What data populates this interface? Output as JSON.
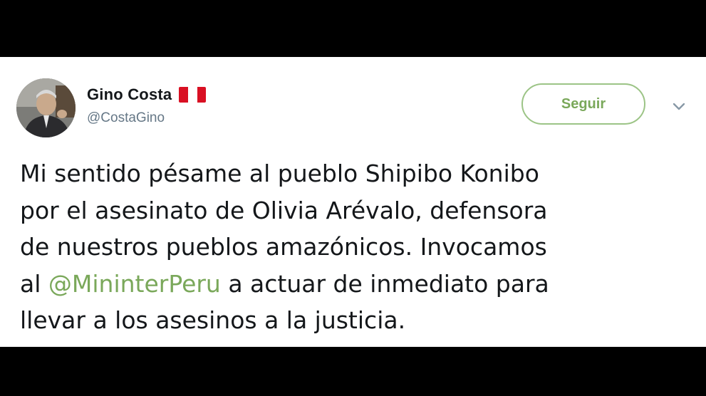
{
  "user": {
    "display_name": "Gino Costa",
    "handle": "@CostaGino",
    "flag_icon": "peru-flag-icon",
    "flag_colors": {
      "red": "#d91023",
      "white": "#ffffff"
    }
  },
  "actions": {
    "follow_label": "Seguir",
    "menu_icon": "chevron-down-icon"
  },
  "tweet": {
    "line1": "Mi sentido pésame al pueblo Shipibo Konibo",
    "line2": "por el asesinato de Olivia Arévalo, defensora",
    "line3": "de nuestros pueblos amazónicos. Invocamos",
    "line4_before": "al ",
    "mention": "@MininterPeru",
    "line4_after": " a actuar de inmediato para",
    "line5": "llevar a los asesinos a la justicia."
  },
  "colors": {
    "accent": "#7aa85a",
    "button_border": "#9cc486",
    "text": "#14171a",
    "secondary": "#657786"
  }
}
